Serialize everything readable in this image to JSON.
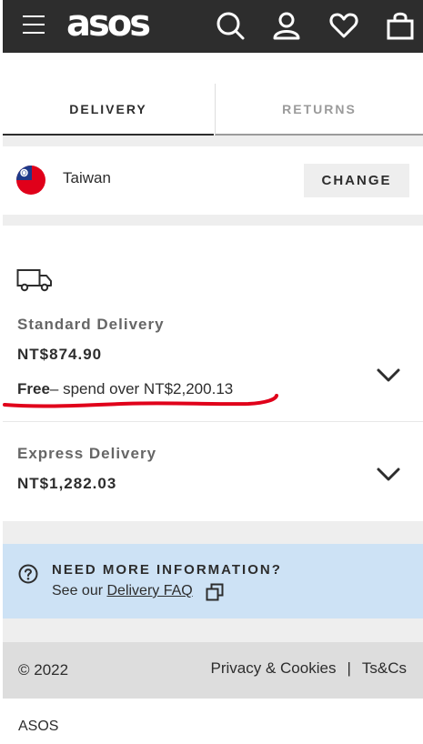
{
  "header": {
    "logo": "asos",
    "icons": [
      "menu-icon",
      "search-icon",
      "account-icon",
      "heart-icon",
      "bag-icon"
    ]
  },
  "tabs": [
    {
      "label": "DELIVERY",
      "active": true
    },
    {
      "label": "RETURNS",
      "active": false
    }
  ],
  "country": {
    "name": "Taiwan",
    "flag": "taiwan-flag-icon",
    "change_label": "CHANGE"
  },
  "delivery_options": [
    {
      "title": "Standard Delivery",
      "price": "NT$874.90",
      "free_label": "Free",
      "free_text": "– spend over NT$2,200.13"
    },
    {
      "title": "Express Delivery",
      "price": "NT$1,282.03"
    }
  ],
  "info": {
    "title": "NEED MORE INFORMATION?",
    "text_prefix": "See our ",
    "link_label": "Delivery FAQ"
  },
  "footer": {
    "copyright": "© 2022",
    "privacy": "Privacy & Cookies",
    "separator": "|",
    "terms": "Ts&Cs",
    "brand": "ASOS"
  },
  "colors": {
    "header_bg": "#2d2d2d",
    "info_bg": "#cde2f5",
    "footer_bg": "#dddddd",
    "annotation_red": "#e0001a"
  }
}
